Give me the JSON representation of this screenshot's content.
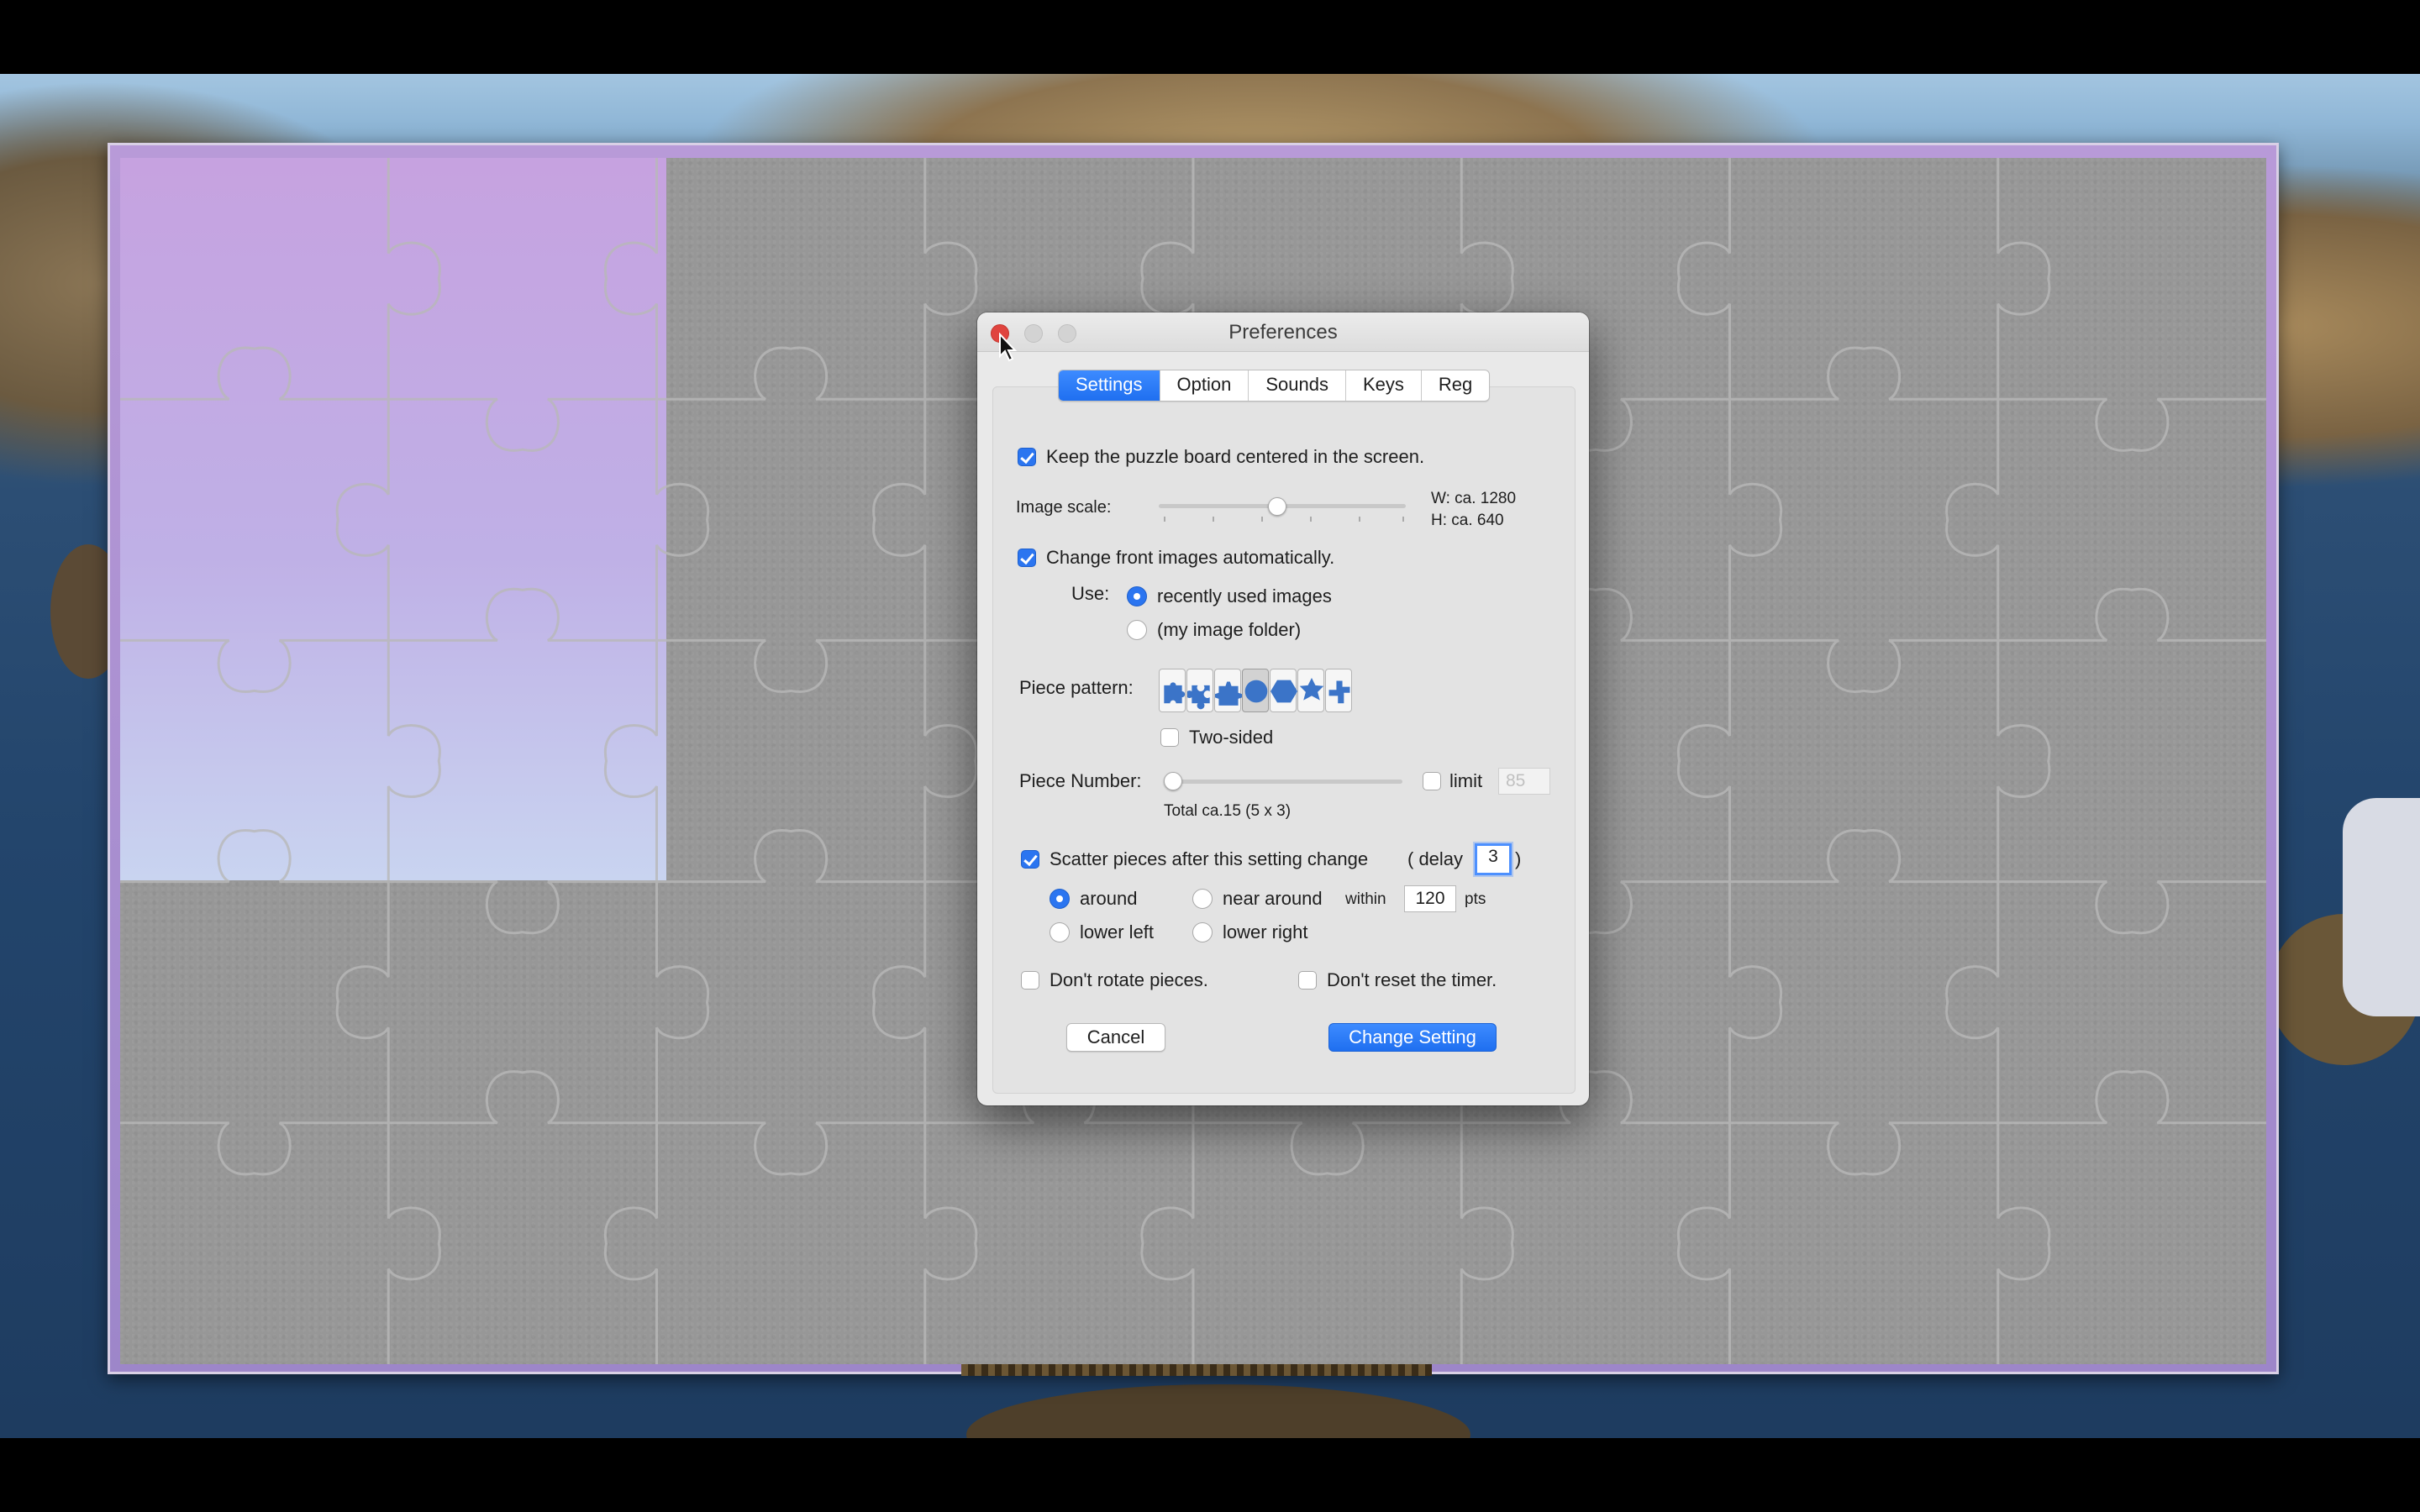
{
  "dialog": {
    "title": "Preferences",
    "tabs": [
      {
        "label": "Settings",
        "active": true
      },
      {
        "label": "Option",
        "active": false
      },
      {
        "label": "Sounds",
        "active": false
      },
      {
        "label": "Keys",
        "active": false
      },
      {
        "label": "Reg",
        "active": false
      }
    ],
    "keep_centered": {
      "label": "Keep the puzzle board centered in the screen.",
      "checked": true
    },
    "image_scale": {
      "label": "Image scale:",
      "level": 0.48,
      "width_text": "W: ca. 1280",
      "height_text": "H: ca. 640"
    },
    "change_front": {
      "label": "Change front images automatically.",
      "checked": true
    },
    "use": {
      "label": "Use:",
      "options": [
        {
          "label": "recently used images",
          "selected": true
        },
        {
          "label": "(my image folder)",
          "selected": false
        }
      ]
    },
    "piece_pattern": {
      "label": "Piece pattern:",
      "patterns": [
        "classic-piece-icon",
        "classic-round-piece-icon",
        "wavy-piece-icon",
        "circle-piece-icon",
        "hexagon-piece-icon",
        "star-piece-icon",
        "spiral-piece-icon"
      ],
      "selected_index": 3
    },
    "two_sided": {
      "label": "Two-sided",
      "checked": false
    },
    "piece_number": {
      "label": "Piece Number:",
      "level": 0.0,
      "total_text": "Total ca.15 (5 x 3)",
      "limit_label": "limit",
      "limit_checked": false,
      "limit_value": "85"
    },
    "scatter": {
      "label": "Scatter pieces after this setting change",
      "checked": true,
      "delay_prefix": "( delay",
      "delay_value": "3",
      "delay_suffix": ")",
      "options": [
        {
          "label": "around",
          "selected": true
        },
        {
          "label": "near around",
          "selected": false
        },
        {
          "label": "lower left",
          "selected": false
        },
        {
          "label": "lower right",
          "selected": false
        }
      ],
      "within_label": "within",
      "within_value": "120",
      "pts_label": "pts"
    },
    "dont_rotate": {
      "label": "Don't rotate pieces.",
      "checked": false
    },
    "dont_reset": {
      "label": "Don't reset the timer.",
      "checked": false
    },
    "cancel_label": "Cancel",
    "change_label": "Change Setting"
  },
  "colors": {
    "accent": "#2b75f0",
    "board": "#979797",
    "frame": "#b89ad8",
    "close_button": "#e0443e"
  }
}
